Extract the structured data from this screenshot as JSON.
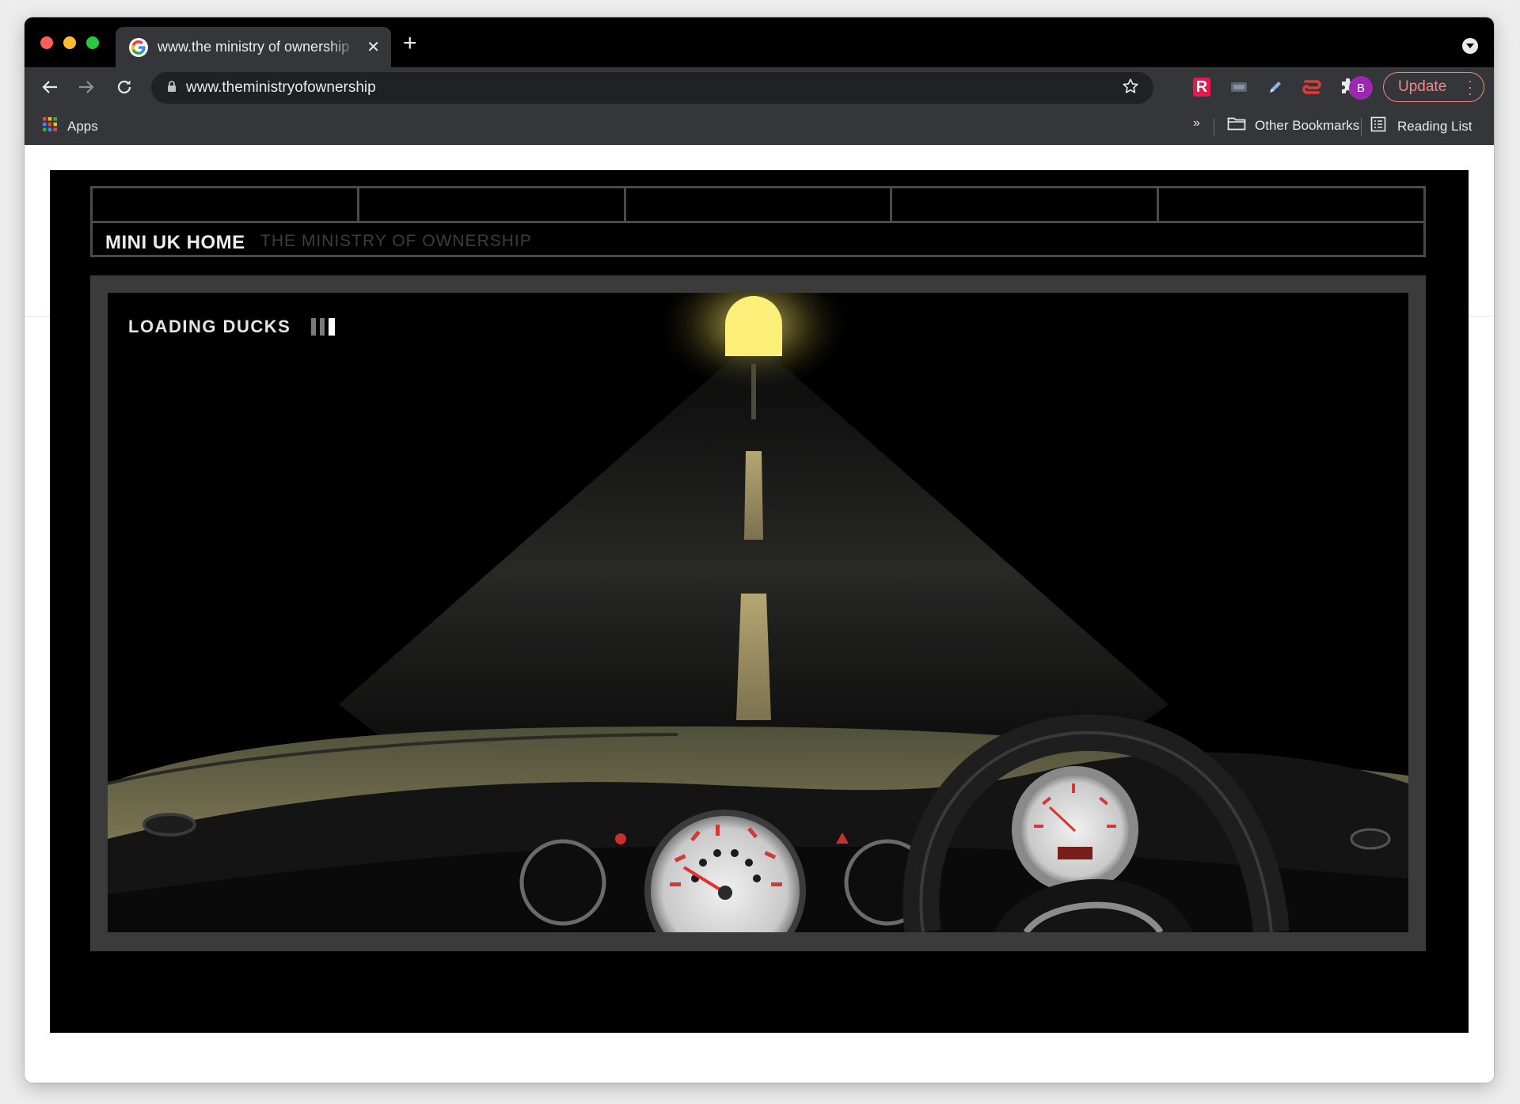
{
  "browser": {
    "tab": {
      "title": "www.the ministry of ownership",
      "close_icon": "close-icon"
    },
    "new_tab_label": "+",
    "address": {
      "url": "www.theministryofownership"
    },
    "profile_initial": "B",
    "update_label": "Update",
    "bookmarks": {
      "apps_label": "Apps",
      "overflow_label": "»",
      "other_label": "Other Bookmarks",
      "reading_list_label": "Reading List"
    }
  },
  "site": {
    "nav": {
      "home_label": "MINI UK HOME",
      "subtitle": "THE MINISTRY OF OWNERSHIP"
    },
    "loader": {
      "label": "LOADING  DUCKS",
      "progress_steps": 3,
      "progress_current": 3
    }
  },
  "colors": {
    "tab_bar": "#000000",
    "toolbar": "#35363a",
    "omnibox": "#202124",
    "update_accent": "#f28b82",
    "avatar": "#9c27b0",
    "tunnel_light": "#fbef7a",
    "road_lines": "#8f845f",
    "gauge_needles": "#e0322f"
  }
}
